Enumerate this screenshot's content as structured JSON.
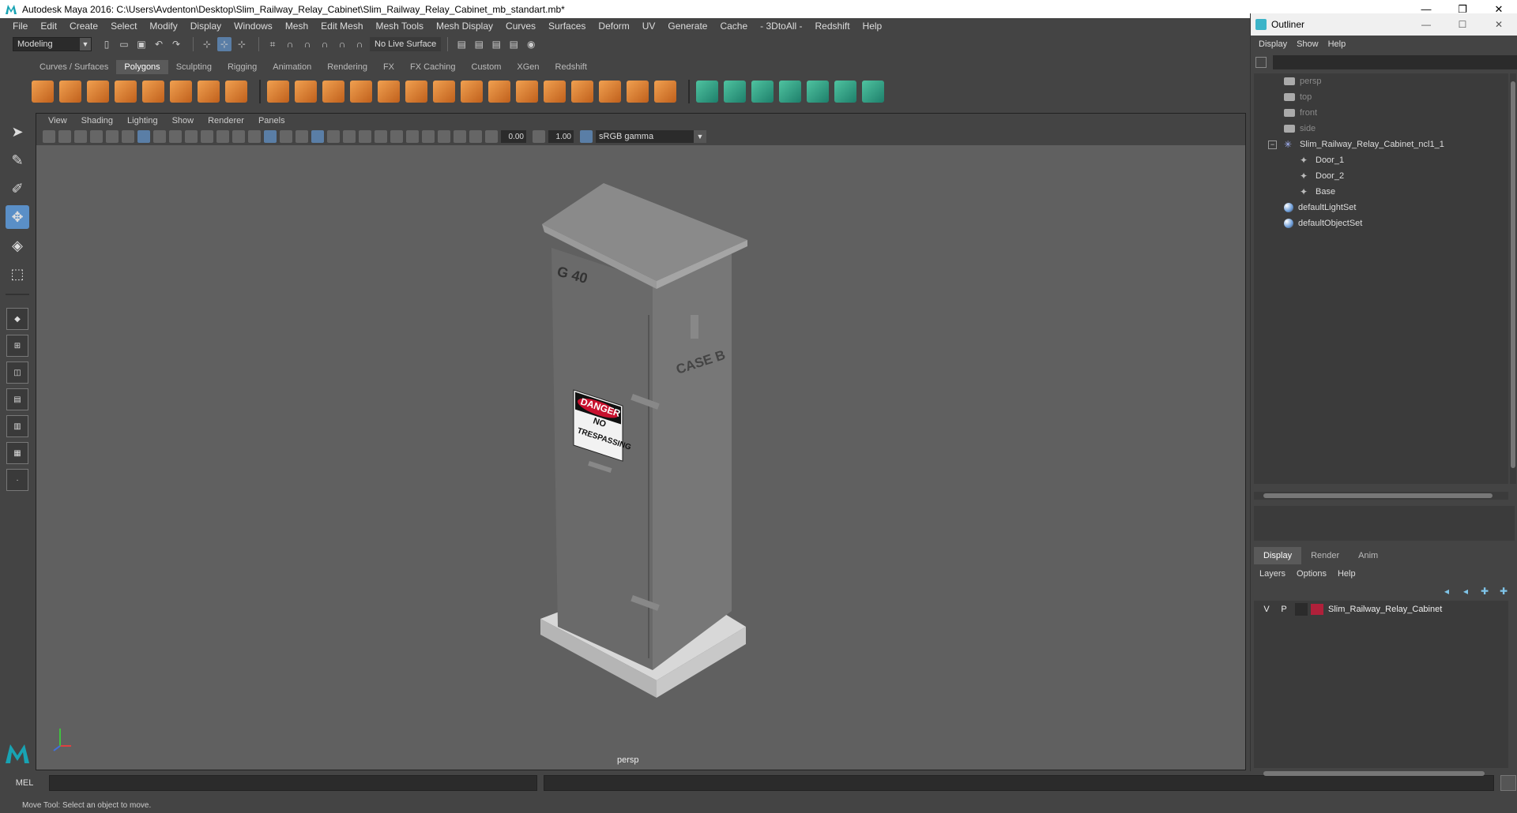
{
  "window": {
    "title": "Autodesk Maya 2016: C:\\Users\\Avdenton\\Desktop\\Slim_Railway_Relay_Cabinet\\Slim_Railway_Relay_Cabinet_mb_standart.mb*",
    "minimize": "—",
    "restore": "❐",
    "close": "✕"
  },
  "menubar": [
    "File",
    "Edit",
    "Create",
    "Select",
    "Modify",
    "Display",
    "Windows",
    "Mesh",
    "Edit Mesh",
    "Mesh Tools",
    "Mesh Display",
    "Curves",
    "Surfaces",
    "Deform",
    "UV",
    "Generate",
    "Cache",
    "- 3DtoAll -",
    "Redshift",
    "Help"
  ],
  "toolbar": {
    "mode": "Modeling",
    "live_surface": "No Live Surface"
  },
  "shelf_tabs": [
    "Curves / Surfaces",
    "Polygons",
    "Sculpting",
    "Rigging",
    "Animation",
    "Rendering",
    "FX",
    "FX Caching",
    "Custom",
    "XGen",
    "Redshift"
  ],
  "shelf_active": "Polygons",
  "viewport": {
    "menu": [
      "View",
      "Shading",
      "Lighting",
      "Show",
      "Renderer",
      "Panels"
    ],
    "field_a": "0.00",
    "field_b": "1.00",
    "color_space": "sRGB gamma",
    "camera_label": "persp",
    "model_labels": {
      "id": "G 40",
      "case": "CASE B",
      "sign_top": "DANGER",
      "sign_bottom_1": "NO",
      "sign_bottom_2": "TRESPASSING"
    }
  },
  "cmdline": {
    "label": "MEL"
  },
  "status": {
    "help_line": "Move Tool: Select an object to move."
  },
  "outliner": {
    "title": "Outliner",
    "menu": [
      "Display",
      "Show",
      "Help"
    ],
    "items": {
      "persp": "persp",
      "top": "top",
      "front": "front",
      "side": "side",
      "group": "Slim_Railway_Relay_Cabinet_ncl1_1",
      "door1": "Door_1",
      "door2": "Door_2",
      "base": "Base",
      "light_set": "defaultLightSet",
      "object_set": "defaultObjectSet"
    }
  },
  "layer_editor": {
    "tabs": [
      "Display",
      "Render",
      "Anim"
    ],
    "menu": [
      "Layers",
      "Options",
      "Help"
    ],
    "layer": {
      "v": "V",
      "p": "P",
      "name": "Slim_Railway_Relay_Cabinet",
      "color": "#b0203a"
    }
  },
  "colors": {
    "accent": "#5a8fc7",
    "shelf_orange": "#e58a3a",
    "shelf_teal": "#2fa58a"
  }
}
